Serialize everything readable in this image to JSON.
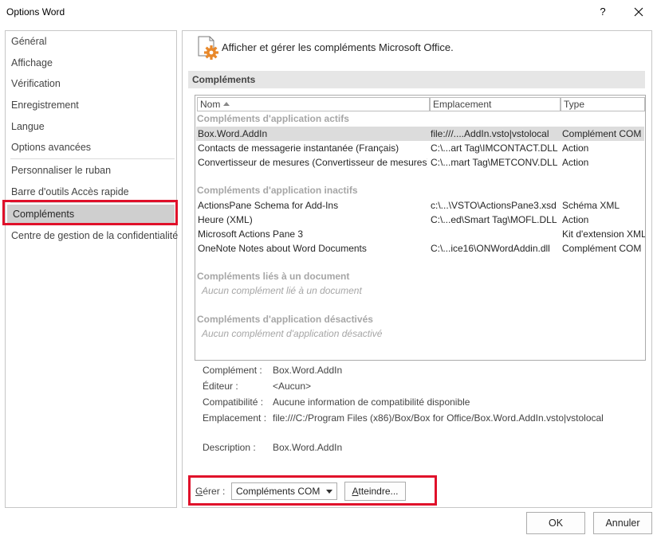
{
  "window": {
    "title": "Options Word",
    "help_label": "?"
  },
  "nav": {
    "items": [
      {
        "label": "Général"
      },
      {
        "label": "Affichage"
      },
      {
        "label": "Vérification"
      },
      {
        "label": "Enregistrement"
      },
      {
        "label": "Langue"
      },
      {
        "label": "Options avancées"
      },
      {
        "label": "Personnaliser le ruban"
      },
      {
        "label": "Barre d'outils Accès rapide"
      },
      {
        "label": "Compléments"
      },
      {
        "label": "Centre de gestion de la confidentialité"
      }
    ],
    "active": "Compléments"
  },
  "header": {
    "text": "Afficher et gérer les compléments Microsoft Office."
  },
  "section": {
    "title": "Compléments"
  },
  "table": {
    "columns": {
      "name": "Nom",
      "location": "Emplacement",
      "type": "Type"
    },
    "groups": [
      {
        "title": "Compléments d'application actifs",
        "rows": [
          {
            "name": "Box.Word.AddIn",
            "location": "file:///....AddIn.vsto|vstolocal",
            "type": "Complément COM"
          },
          {
            "name": "Contacts de messagerie instantanée (Français)",
            "location": "C:\\...art Tag\\IMCONTACT.DLL",
            "type": "Action"
          },
          {
            "name": "Convertisseur de mesures (Convertisseur de mesures)",
            "location": "C:\\...mart Tag\\METCONV.DLL",
            "type": "Action"
          }
        ]
      },
      {
        "title": "Compléments d'application inactifs",
        "rows": [
          {
            "name": "ActionsPane Schema for Add-Ins",
            "location": "c:\\...\\VSTO\\ActionsPane3.xsd",
            "type": "Schéma XML"
          },
          {
            "name": "Heure (XML)",
            "location": "C:\\...ed\\Smart Tag\\MOFL.DLL",
            "type": "Action"
          },
          {
            "name": "Microsoft Actions Pane 3",
            "location": "",
            "type": "Kit d'extension XML"
          },
          {
            "name": "OneNote Notes about Word Documents",
            "location": "C:\\...ice16\\ONWordAddin.dll",
            "type": "Complément COM"
          }
        ]
      },
      {
        "title": "Compléments liés à un document",
        "empty": "Aucun complément lié à un document"
      },
      {
        "title": "Compléments d'application désactivés",
        "empty": "Aucun complément d'application désactivé"
      }
    ]
  },
  "details": {
    "addin_label": "Complément :",
    "addin_value": "Box.Word.AddIn",
    "publisher_label": "Éditeur :",
    "publisher_value": "<Aucun>",
    "compat_label": "Compatibilité :",
    "compat_value": "Aucune information de compatibilité disponible",
    "location_label": "Emplacement :",
    "location_value": "file:///C:/Program Files (x86)/Box/Box for Office/Box.Word.AddIn.vsto|vstolocal",
    "description_label": "Description :",
    "description_value": "Box.Word.AddIn"
  },
  "manage": {
    "label_underlined": "G",
    "label_rest": "érer :",
    "selected": "Compléments COM",
    "go_underlined": "A",
    "go_rest": "tteindre..."
  },
  "footer": {
    "ok_label": "OK",
    "cancel_label": "Annuler"
  },
  "colors": {
    "highlight": "#e0102a",
    "nav_active": "#cfcfcf",
    "group_text": "#a6a6a6"
  }
}
